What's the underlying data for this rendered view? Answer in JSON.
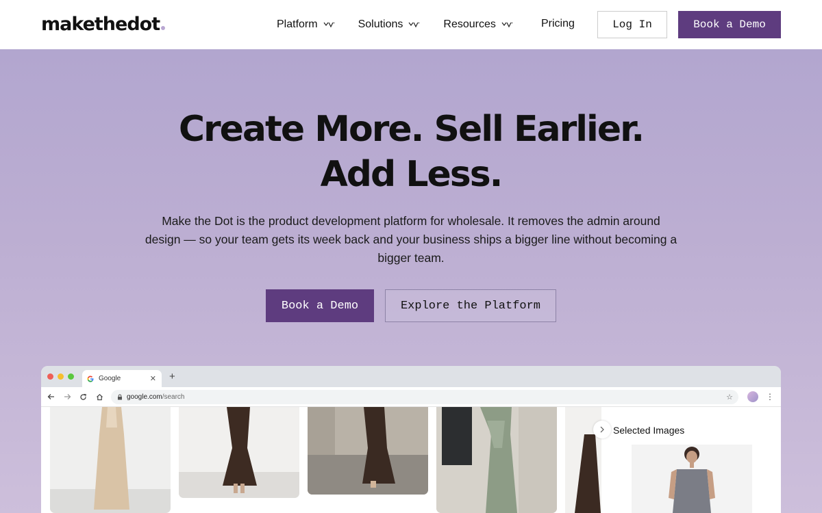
{
  "header": {
    "logo": "makethedot",
    "nav": [
      {
        "label": "Platform"
      },
      {
        "label": "Solutions"
      },
      {
        "label": "Resources"
      }
    ],
    "pricing": "Pricing",
    "login": "Log In",
    "book_demo": "Book a Demo"
  },
  "hero": {
    "title_line1": "Create More. Sell Earlier.",
    "title_line2": "Add Less.",
    "subtitle": "Make the Dot is the product development platform for wholesale. It removes the admin around design — so your team gets its week back and your business ships a bigger line without becoming a bigger team.",
    "primary_cta": "Book a Demo",
    "secondary_cta": "Explore the Platform"
  },
  "browser": {
    "tab_title": "Google",
    "url_host": "google.com",
    "url_path": "/search",
    "panel_title": "Selected Images"
  },
  "colors": {
    "brand_purple": "#5e3c7f",
    "hero_bg": "#b2a6cf"
  }
}
